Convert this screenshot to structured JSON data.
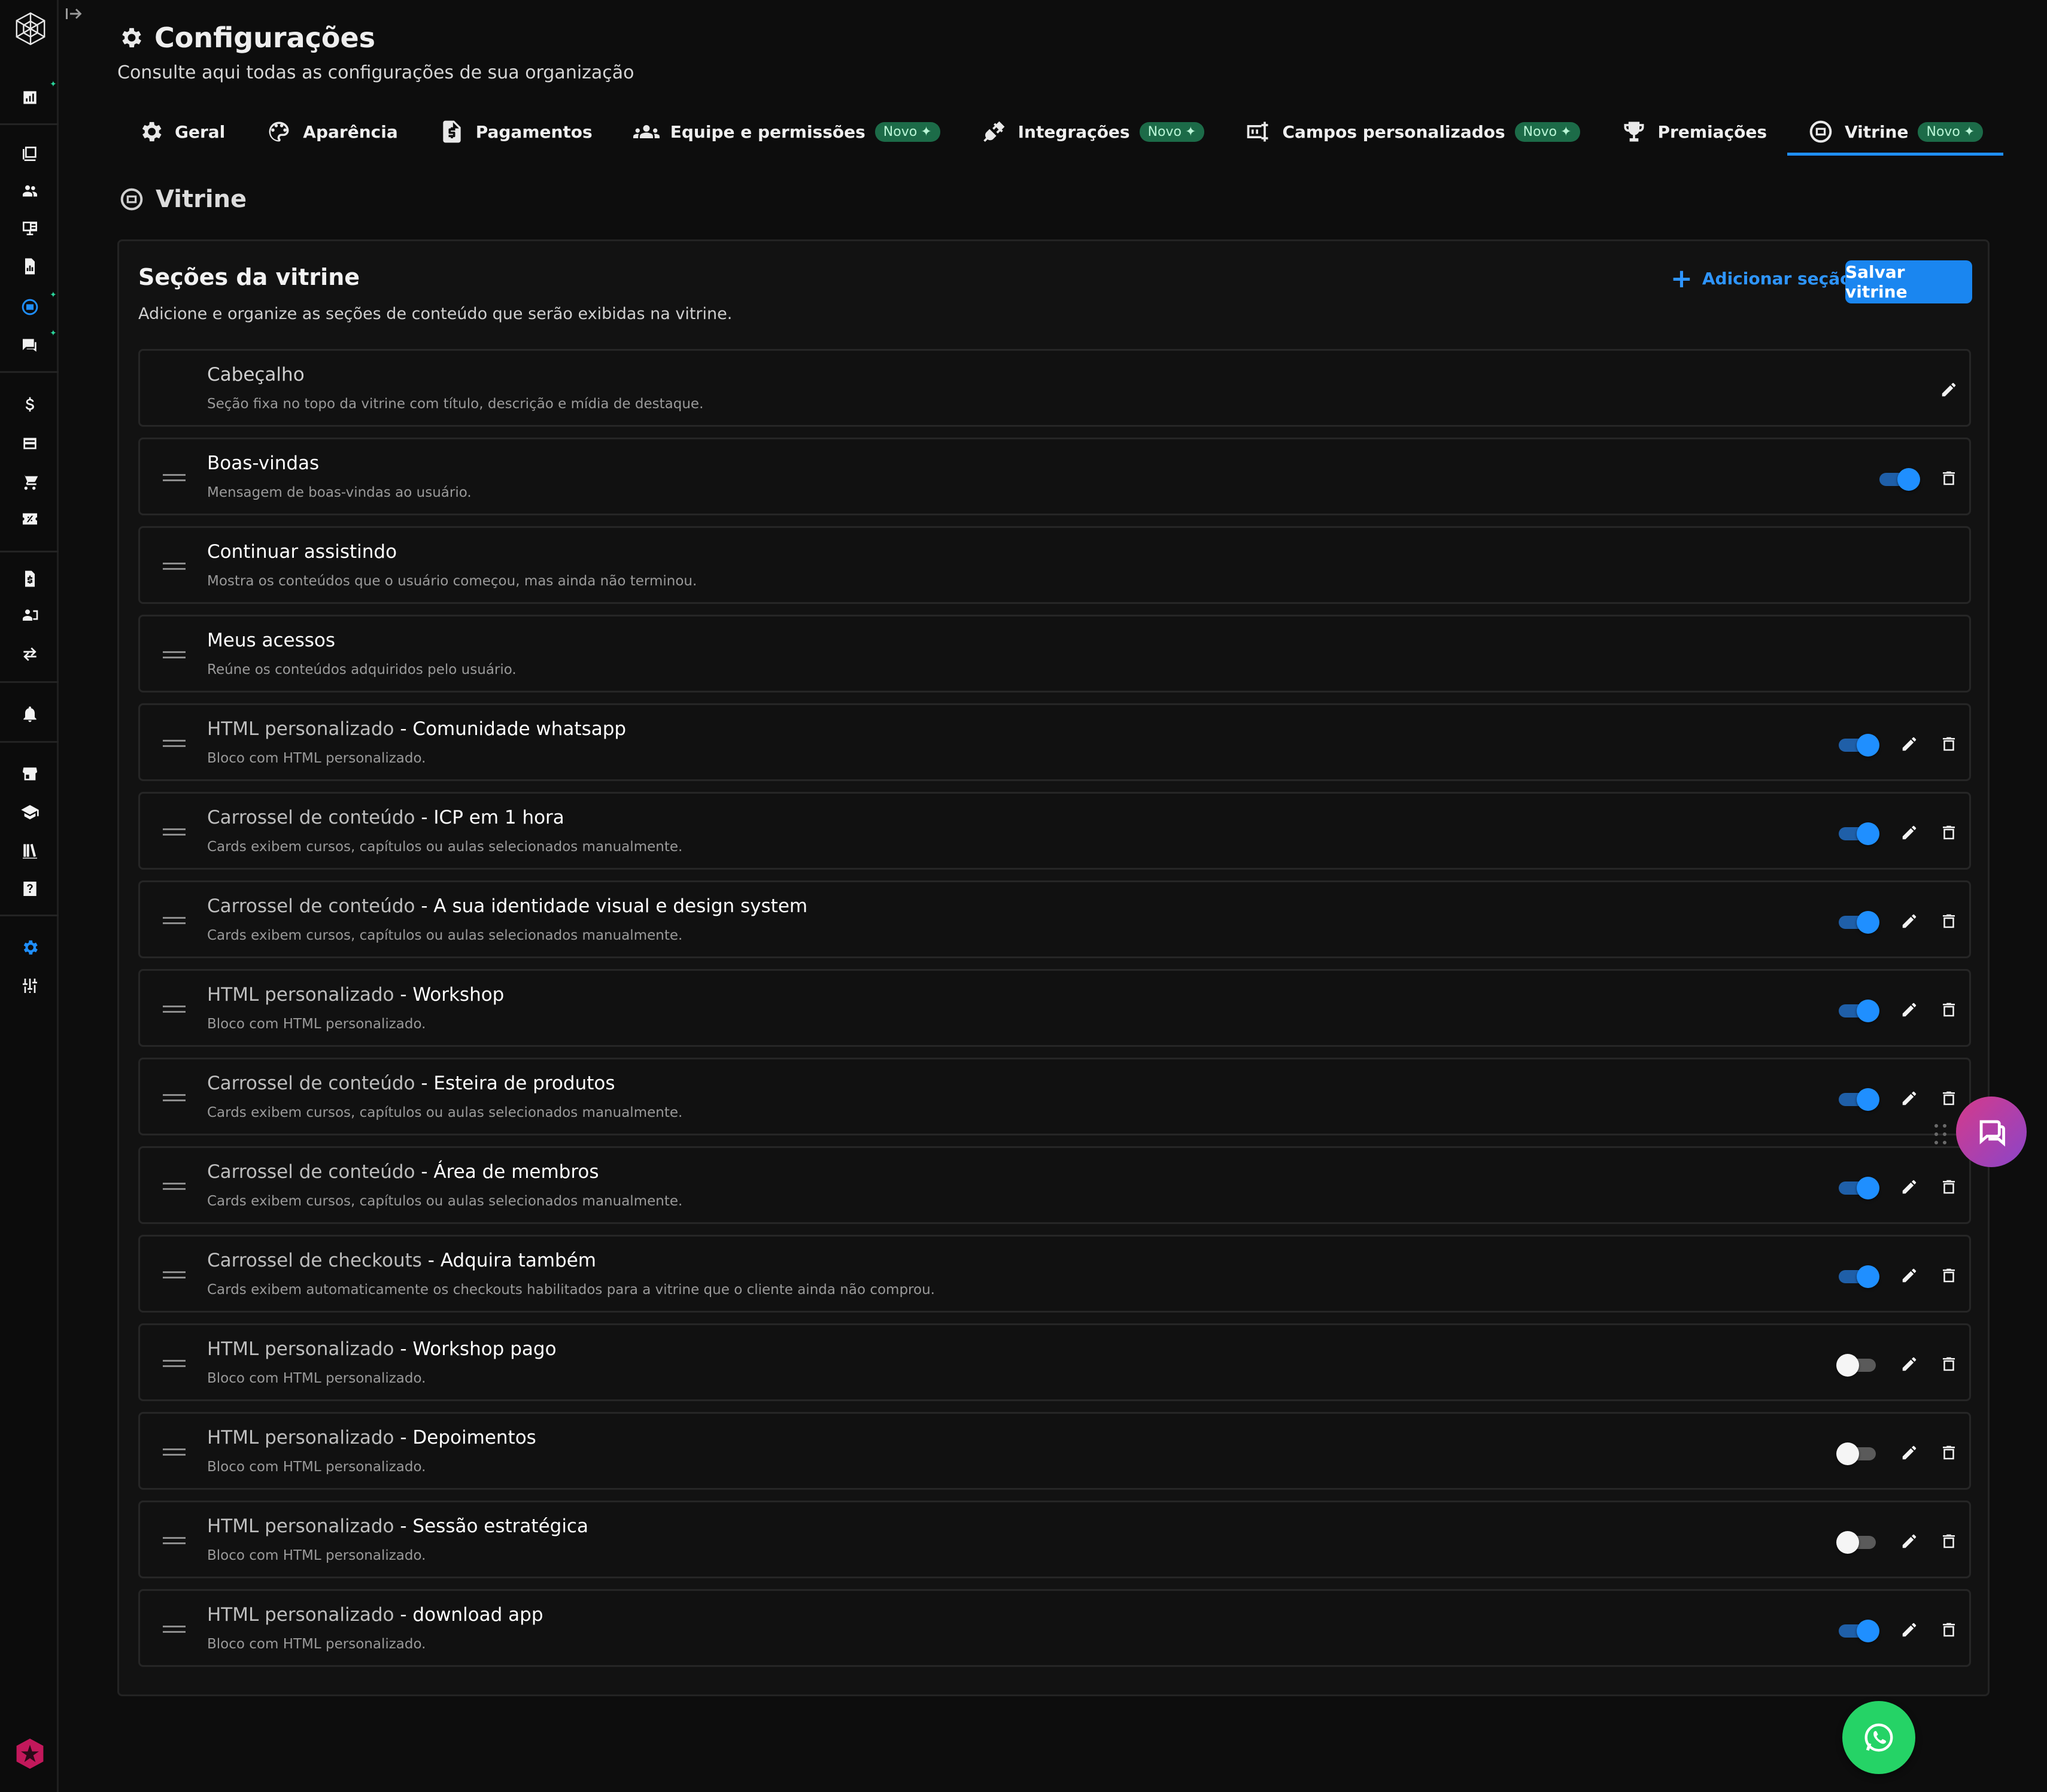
{
  "header": {
    "title": "Configurações",
    "subtitle": "Consulte aqui todas as configurações de sua organização"
  },
  "tabs": [
    {
      "label": "Geral",
      "icon": "gear-icon",
      "badge": ""
    },
    {
      "label": "Aparência",
      "icon": "palette-icon",
      "badge": ""
    },
    {
      "label": "Pagamentos",
      "icon": "invoice-icon",
      "badge": ""
    },
    {
      "label": "Equipe e permissões",
      "icon": "group-icon",
      "badge": "Novo"
    },
    {
      "label": "Integrações",
      "icon": "plug-icon",
      "badge": "Novo"
    },
    {
      "label": "Campos personalizados",
      "icon": "form-fields-icon",
      "badge": "Novo"
    },
    {
      "label": "Premiações",
      "icon": "trophy-icon",
      "badge": ""
    },
    {
      "label": "Vitrine",
      "icon": "showcase-icon",
      "badge": "Novo",
      "active": true
    }
  ],
  "section": {
    "title": "Vitrine"
  },
  "card": {
    "title": "Seções da vitrine",
    "subtitle": "Adicione e organize as seções de conteúdo que serão exibidas na vitrine.",
    "add_label": "Adicionar seção",
    "save_label": "Salvar vitrine"
  },
  "rows": [
    {
      "kind": "",
      "name": "Cabeçalho",
      "desc": "Seção fixa no topo da vitrine com título, descrição e mídia de destaque.",
      "kind_style": "muted-name",
      "toggle": null,
      "edit": true,
      "delete": false,
      "drag": false
    },
    {
      "kind": "",
      "name": "Boas-vindas",
      "desc": "Mensagem de boas-vindas ao usuário.",
      "toggle": true,
      "edit": false,
      "delete": true,
      "drag": true
    },
    {
      "kind": "",
      "name": "Continuar assistindo",
      "desc": "Mostra os conteúdos que o usuário começou, mas ainda não terminou.",
      "toggle": null,
      "edit": false,
      "delete": false,
      "drag": true
    },
    {
      "kind": "",
      "name": "Meus acessos",
      "desc": "Reúne os conteúdos adquiridos pelo usuário.",
      "toggle": null,
      "edit": false,
      "delete": false,
      "drag": true
    },
    {
      "kind": "HTML personalizado",
      "name": "Comunidade whatsapp",
      "desc": "Bloco com HTML personalizado.",
      "toggle": true,
      "edit": true,
      "delete": true,
      "drag": true
    },
    {
      "kind": "Carrossel de conteúdo",
      "name": "ICP em 1 hora",
      "desc": "Cards exibem cursos, capítulos ou aulas selecionados manualmente.",
      "toggle": true,
      "edit": true,
      "delete": true,
      "drag": true
    },
    {
      "kind": "Carrossel de conteúdo",
      "name": "A sua identidade visual e design system",
      "desc": "Cards exibem cursos, capítulos ou aulas selecionados manualmente.",
      "toggle": true,
      "edit": true,
      "delete": true,
      "drag": true
    },
    {
      "kind": "HTML personalizado",
      "name": "Workshop",
      "desc": "Bloco com HTML personalizado.",
      "toggle": true,
      "edit": true,
      "delete": true,
      "drag": true
    },
    {
      "kind": "Carrossel de conteúdo",
      "name": "Esteira de produtos",
      "desc": "Cards exibem cursos, capítulos ou aulas selecionados manualmente.",
      "toggle": true,
      "edit": true,
      "delete": true,
      "drag": true
    },
    {
      "kind": "Carrossel de conteúdo",
      "name": "Área de membros",
      "desc": "Cards exibem cursos, capítulos ou aulas selecionados manualmente.",
      "toggle": true,
      "edit": true,
      "delete": true,
      "drag": true
    },
    {
      "kind": "Carrossel de checkouts",
      "name": "Adquira também",
      "desc": "Cards exibem automaticamente os checkouts habilitados para a vitrine que o cliente ainda não comprou.",
      "toggle": true,
      "edit": true,
      "delete": true,
      "drag": true
    },
    {
      "kind": "HTML personalizado",
      "name": "Workshop pago",
      "desc": "Bloco com HTML personalizado.",
      "toggle": false,
      "edit": true,
      "delete": true,
      "drag": true
    },
    {
      "kind": "HTML personalizado",
      "name": "Depoimentos",
      "desc": "Bloco com HTML personalizado.",
      "toggle": false,
      "edit": true,
      "delete": true,
      "drag": true
    },
    {
      "kind": "HTML personalizado",
      "name": "Sessão estratégica",
      "desc": "Bloco com HTML personalizado.",
      "toggle": false,
      "edit": true,
      "delete": true,
      "drag": true
    },
    {
      "kind": "HTML personalizado",
      "name": "download app",
      "desc": "Bloco com HTML personalizado.",
      "toggle": true,
      "edit": true,
      "delete": true,
      "drag": true
    }
  ],
  "sidebar": {
    "icons": [
      "dashboard-icon",
      "library-icon",
      "users-icon",
      "reports-icon",
      "document-chart-icon",
      "showcase-icon",
      "comments-icon",
      "dollar-icon",
      "wallet-icon",
      "cart-icon",
      "coupon-icon",
      "invoice-icon",
      "member-id-icon",
      "transfer-icon",
      "bell-icon",
      "store-icon",
      "graduation-icon",
      "books-icon",
      "help-icon",
      "settings-icon",
      "sliders-icon"
    ]
  },
  "colors": {
    "accent": "#1f8fff",
    "badge_bg": "#1c6b48",
    "whatsapp": "#25d366"
  }
}
